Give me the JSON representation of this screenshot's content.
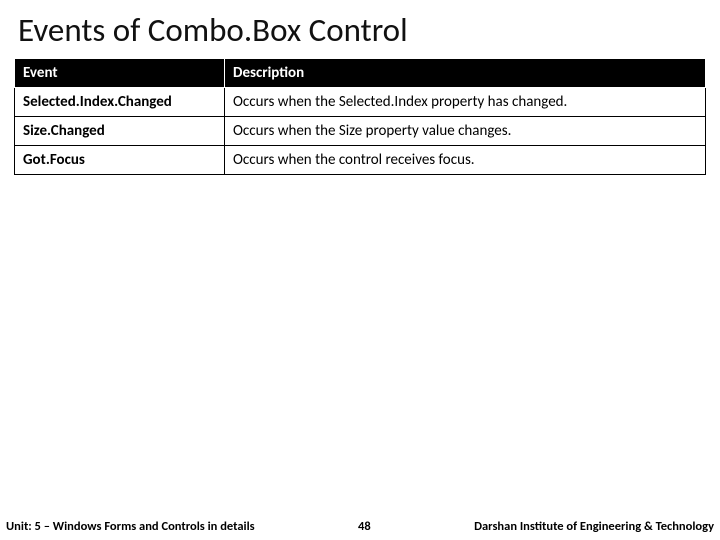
{
  "title": "Events of Combo.Box Control",
  "table": {
    "headers": {
      "event": "Event",
      "description": "Description"
    },
    "rows": [
      {
        "event": "Selected.Index.Changed",
        "description": "Occurs when the Selected.Index property has changed."
      },
      {
        "event": "Size.Changed",
        "description": "Occurs when the Size property value changes."
      },
      {
        "event": "Got.Focus",
        "description": "Occurs when the control receives focus."
      }
    ]
  },
  "footer": {
    "unit": "Unit: 5 – Windows Forms and Controls in details",
    "page": "48",
    "institute": "Darshan Institute of Engineering & Technology"
  }
}
